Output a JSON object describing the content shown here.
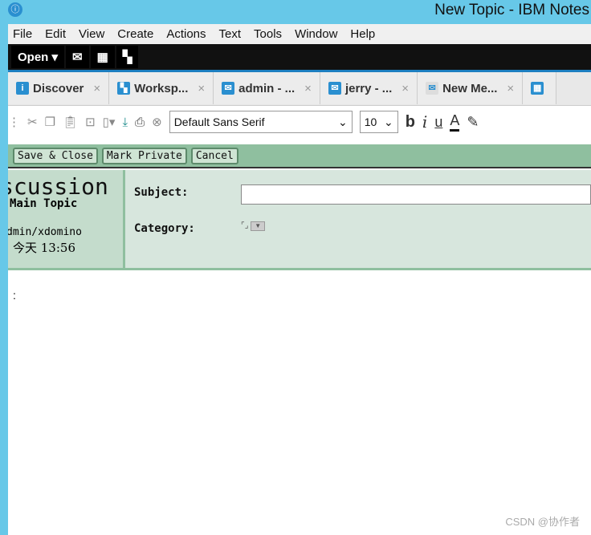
{
  "window": {
    "title": "New Topic - IBM Notes"
  },
  "menu": [
    "File",
    "Edit",
    "View",
    "Create",
    "Actions",
    "Text",
    "Tools",
    "Window",
    "Help"
  ],
  "toolbar": {
    "open_label": "Open"
  },
  "tabs": [
    {
      "label": "Discover",
      "icon": "info-icon"
    },
    {
      "label": "Worksp...",
      "icon": "workspace-icon"
    },
    {
      "label": "admin - ...",
      "icon": "mail-icon"
    },
    {
      "label": "jerry - ...",
      "icon": "mail-icon"
    },
    {
      "label": "New Me...",
      "icon": "new-memo-icon"
    },
    {
      "label": "",
      "icon": "calendar-icon"
    }
  ],
  "format": {
    "font": "Default Sans Serif",
    "size": "10"
  },
  "actions": {
    "save_close": "Save & Close",
    "mark_private": "Mark Private",
    "cancel": "Cancel"
  },
  "header": {
    "form_title": "scussion",
    "form_sub": "Main Topic",
    "author": "dmin/xdomino",
    "time": "今天 13:56",
    "subject_label": "Subject:",
    "subject_value": "",
    "category_label": "Category:"
  },
  "body": {
    "text": ":"
  },
  "watermark": "CSDN @协作者",
  "colors": {
    "title_bar": "#67c8e8",
    "action_bar": "#8fbf9f",
    "header_bg": "#d7e6dd"
  }
}
